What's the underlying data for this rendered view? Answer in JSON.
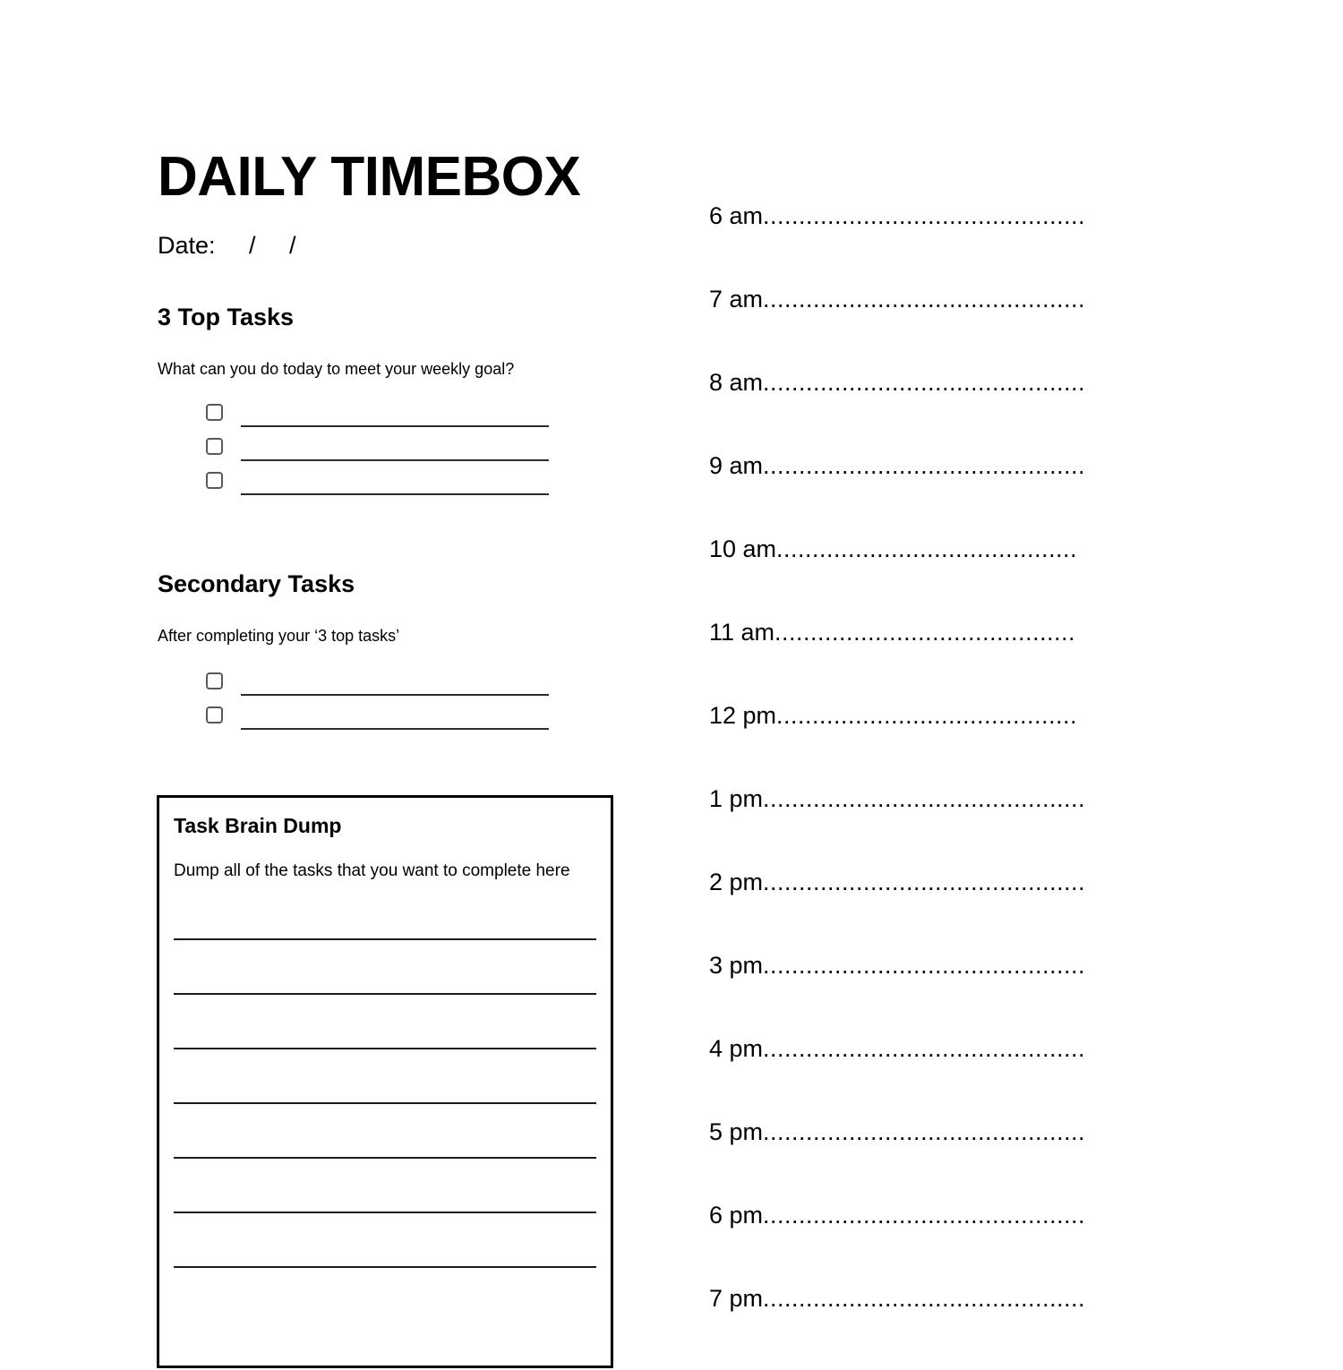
{
  "document": {
    "title": "DAILY TIMEBOX",
    "date_line": "Date:     /     /"
  },
  "top_tasks": {
    "heading": "3 Top Tasks",
    "prompt": "What can you do today to meet your weekly goal?",
    "items": [
      {
        "checked": false,
        "value": ""
      },
      {
        "checked": false,
        "value": ""
      },
      {
        "checked": false,
        "value": ""
      }
    ]
  },
  "secondary_tasks": {
    "heading": "Secondary Tasks",
    "prompt": "After completing your ‘3 top tasks’",
    "items": [
      {
        "checked": false,
        "value": ""
      },
      {
        "checked": false,
        "value": ""
      }
    ]
  },
  "brain_dump": {
    "heading": "Task Brain Dump",
    "prompt": "Dump all of the tasks that you want to complete here",
    "lines": [
      "",
      "",
      "",
      "",
      "",
      "",
      ""
    ]
  },
  "schedule": {
    "slots": [
      {
        "label": "6 am",
        "dots": ".............................................",
        "value": ""
      },
      {
        "label": "7 am",
        "dots": ".............................................",
        "value": ""
      },
      {
        "label": "8 am",
        "dots": ".............................................",
        "value": ""
      },
      {
        "label": "9 am",
        "dots": ".............................................",
        "value": ""
      },
      {
        "label": "10 am",
        "dots": "..........................................",
        "value": ""
      },
      {
        "label": "11 am",
        "dots": "..........................................",
        "value": ""
      },
      {
        "label": "12 pm",
        "dots": "..........................................",
        "value": ""
      },
      {
        "label": "1 pm",
        "dots": ".............................................",
        "value": ""
      },
      {
        "label": "2 pm",
        "dots": ".............................................",
        "value": ""
      },
      {
        "label": "3 pm",
        "dots": ".............................................",
        "value": ""
      },
      {
        "label": "4 pm",
        "dots": ".............................................",
        "value": ""
      },
      {
        "label": "5 pm",
        "dots": ".............................................",
        "value": ""
      },
      {
        "label": "6 pm",
        "dots": ".............................................",
        "value": ""
      },
      {
        "label": "7 pm",
        "dots": ".............................................",
        "value": ""
      }
    ]
  },
  "colors": {
    "ink": "#000000",
    "rule": "#2b2b2b",
    "checkbox_border": "#595959",
    "box_border": "#000000",
    "paper": "#ffffff"
  }
}
